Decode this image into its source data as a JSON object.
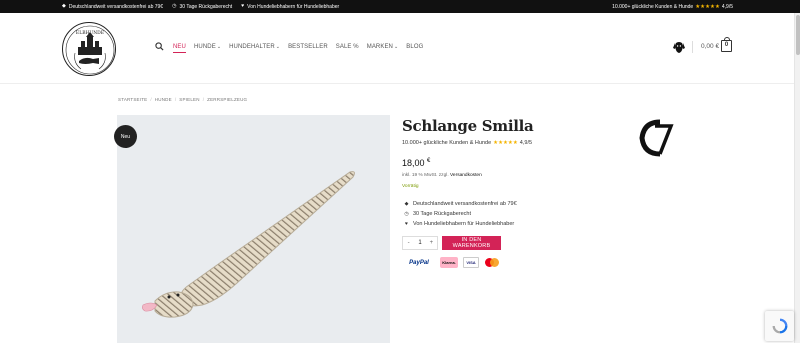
{
  "topbar": {
    "items": [
      {
        "icon": "tag-icon",
        "text": "Deutschlandweit versandkostenfrei ab 79€"
      },
      {
        "icon": "clock-icon",
        "text": "30 Tage Rückgaberecht"
      },
      {
        "icon": "heart-icon",
        "text": "Von Hundeliebhabern für Hundeliebhaber"
      }
    ],
    "reviews_text": "10.000+ glückliche Kunden & Hunde",
    "stars": "★★★★★",
    "rating": "4,9/5"
  },
  "header": {
    "logo_text": "ELBHUNDE",
    "nav": [
      {
        "label": "Neu",
        "active": true,
        "dropdown": false
      },
      {
        "label": "Hunde",
        "active": false,
        "dropdown": true
      },
      {
        "label": "Hundehalter",
        "active": false,
        "dropdown": true
      },
      {
        "label": "Bestseller",
        "active": false,
        "dropdown": false
      },
      {
        "label": "Sale %",
        "active": false,
        "dropdown": false
      },
      {
        "label": "Marken",
        "active": false,
        "dropdown": true
      },
      {
        "label": "Blog",
        "active": false,
        "dropdown": false
      }
    ],
    "cart_total": "0,00 €",
    "cart_count": "0"
  },
  "breadcrumb": [
    "Startseite",
    "Hunde",
    "Spielen",
    "Zerrspielzeug"
  ],
  "product": {
    "badge": "Neu",
    "title": "Schlange Smilla",
    "rating_text": "10.000+ glückliche Kunden & Hunde",
    "stars": "★★★★★",
    "rating": "4,9/5",
    "price": "18,00",
    "currency": "€",
    "tax_note": "inkl. 19 % MwSt. zzgl.",
    "shipping_link": "Versandkosten",
    "stock": "Vorrätig",
    "benefits": [
      {
        "icon": "tag-icon",
        "text": "Deutschlandweit versandkostenfrei ab 79€"
      },
      {
        "icon": "clock-icon",
        "text": "30 Tage Rückgaberecht"
      },
      {
        "icon": "heart-icon",
        "text": "Von Hundeliebhabern für Hundeliebhaber"
      }
    ],
    "qty_minus": "-",
    "qty": "1",
    "qty_plus": "+",
    "add_to_cart": "In den Warenkorb",
    "payments": [
      "PayPal",
      "Klarna.",
      "VISA",
      "Mastercard"
    ]
  },
  "colors": {
    "accent": "#d32357",
    "dark": "#111111",
    "stock": "#7a9a01"
  }
}
